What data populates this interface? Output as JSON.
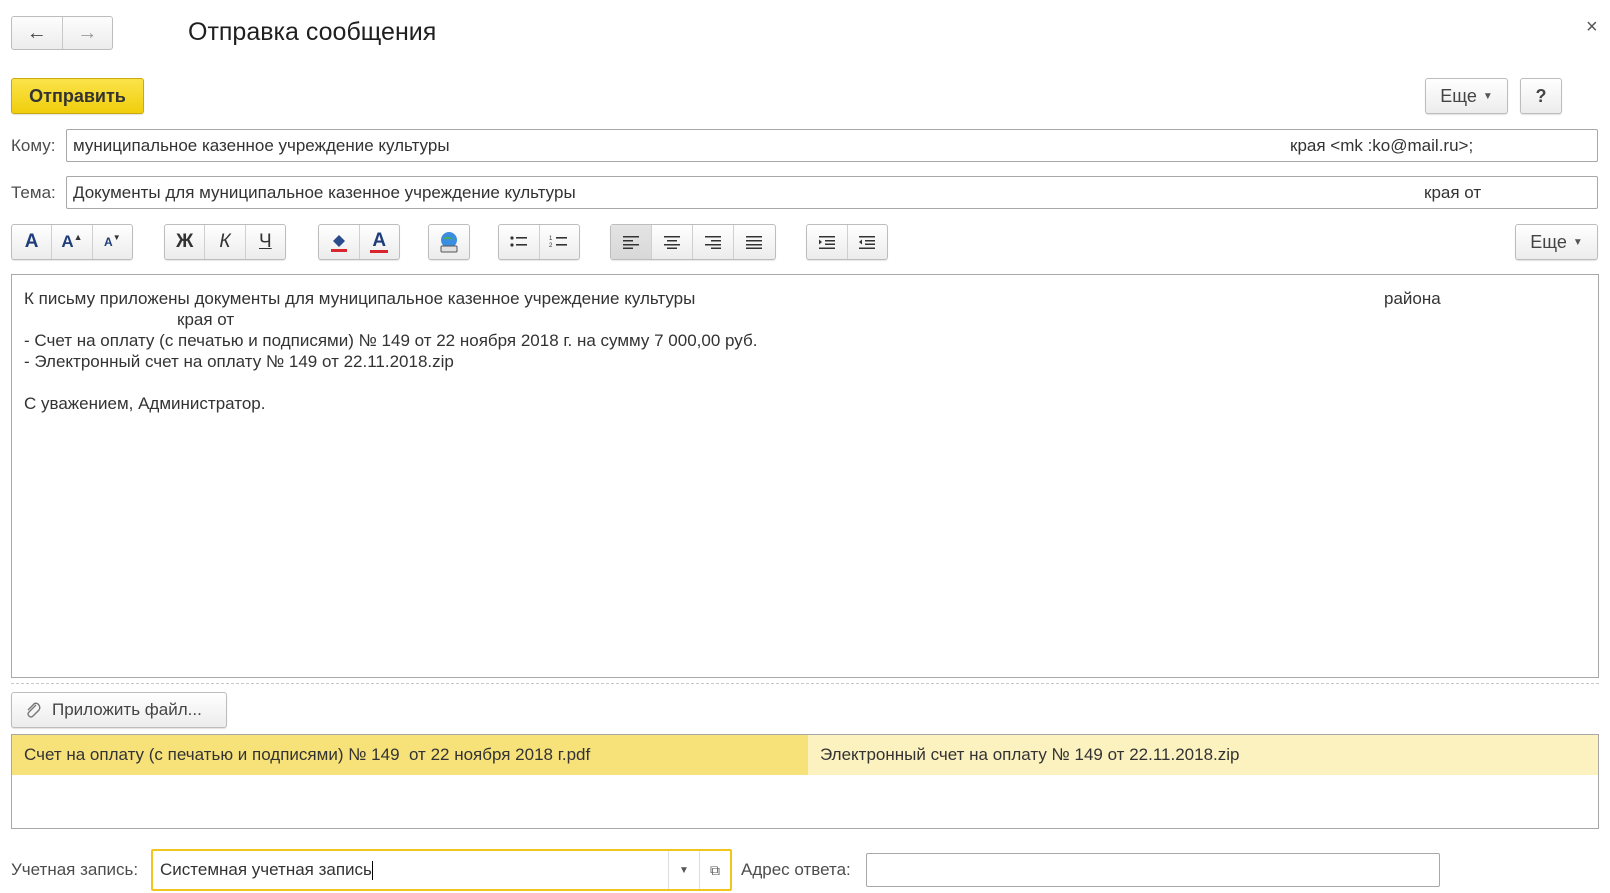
{
  "window": {
    "title": "Отправка сообщения",
    "nav_back": "←",
    "nav_forward": "→",
    "close": "×"
  },
  "commandbar": {
    "send_label": "Отправить",
    "more_label": "Еще",
    "help_label": "?"
  },
  "to": {
    "label": "Кому:",
    "value_left": "муниципальное казенное учреждение культуры",
    "value_right": "края <mk     :ko@mail.ru>;"
  },
  "subject": {
    "label": "Тема:",
    "value_left": "Документы для муниципальное казенное учреждение культуры",
    "value_right": "края от"
  },
  "format_toolbar": {
    "font_label": "A",
    "font_bigger": "A",
    "font_smaller": "A",
    "bold": "Ж",
    "italic": "К",
    "underline": "Ч",
    "text_color": "A",
    "more_label": "Еще"
  },
  "body": {
    "line1": "К письму приложены документы для муниципальное казенное учреждение культуры",
    "line1_right": "района",
    "line2": "края от",
    "line3": "- Счет на оплату (с печатью и подписями) № 149 от 22 ноября 2018 г. на сумму 7 000,00 руб.",
    "line4": "- Электронный счет на оплату № 149 от 22.11.2018.zip",
    "line5": "С уважением, Администратор."
  },
  "attachments": {
    "button_label": "Приложить файл...",
    "files": [
      "Счет на оплату (с печатью и подписями) № 149  от 22 ноября 2018 г.pdf",
      "Электронный счет на оплату № 149 от 22.11.2018.zip"
    ]
  },
  "account": {
    "label": "Учетная запись:",
    "value": "Системная учетная запись"
  },
  "reply": {
    "label": "Адрес ответа:",
    "value": ""
  },
  "colors": {
    "accent_yellow": "#f0ce0c",
    "selected_file": "#f7e27a",
    "file_bg": "#fcf2c0"
  }
}
